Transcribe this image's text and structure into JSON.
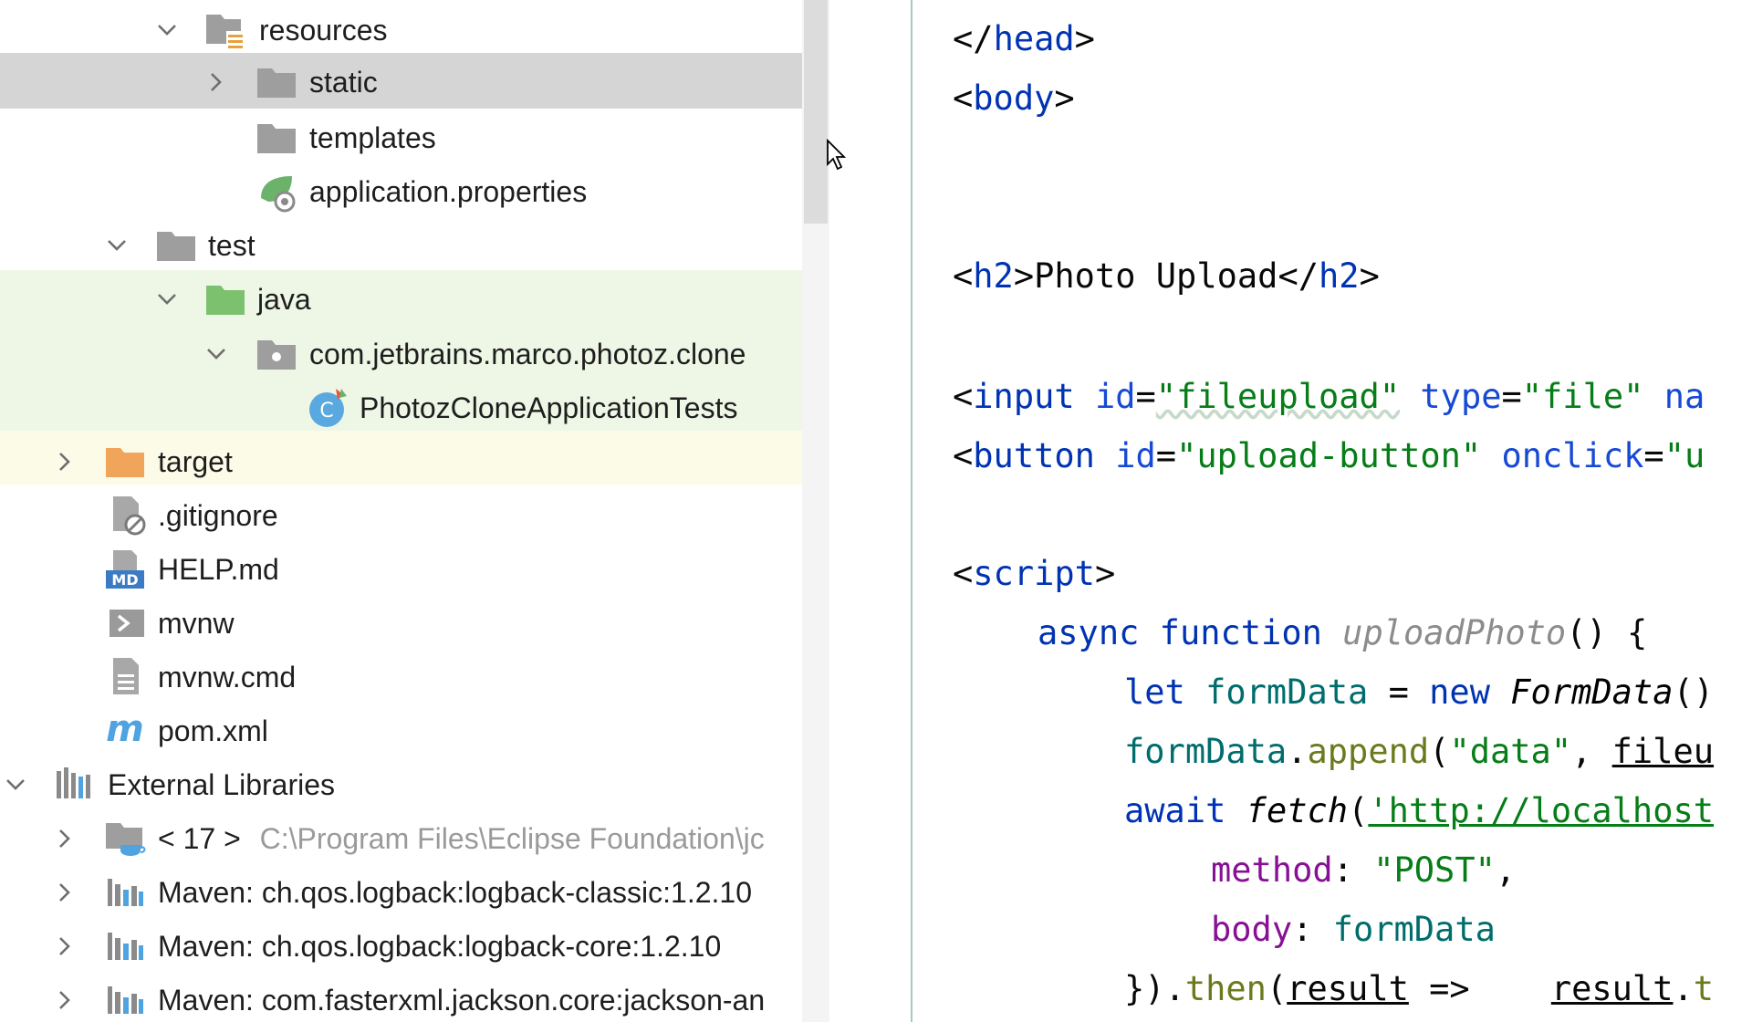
{
  "project_tree": {
    "rows": [
      {
        "label": "resources",
        "icon": "resources-folder-icon"
      },
      {
        "label": "static",
        "icon": "folder-icon"
      },
      {
        "label": "templates",
        "icon": "folder-icon"
      },
      {
        "label": "application.properties",
        "icon": "spring-properties-icon"
      },
      {
        "label": "test",
        "icon": "folder-icon"
      },
      {
        "label": "java",
        "icon": "test-source-folder-icon"
      },
      {
        "label": "com.jetbrains.marco.photoz.clone",
        "icon": "package-icon"
      },
      {
        "label": "PhotozCloneApplicationTests",
        "icon": "test-class-icon"
      },
      {
        "label": "target",
        "icon": "excluded-folder-icon"
      },
      {
        "label": ".gitignore",
        "icon": "ignored-file-icon"
      },
      {
        "label": "HELP.md",
        "icon": "markdown-file-icon"
      },
      {
        "label": "mvnw",
        "icon": "shell-script-icon"
      },
      {
        "label": "mvnw.cmd",
        "icon": "text-file-icon"
      },
      {
        "label": "pom.xml",
        "icon": "maven-icon"
      },
      {
        "label": "External Libraries",
        "icon": "libraries-icon"
      },
      {
        "label": "< 17 >",
        "sublabel": "C:\\Program Files\\Eclipse Foundation\\jc",
        "icon": "jdk-icon"
      },
      {
        "label": "Maven: ch.qos.logback:logback-classic:1.2.10",
        "icon": "library-icon"
      },
      {
        "label": "Maven: ch.qos.logback:logback-core:1.2.10",
        "icon": "library-icon"
      },
      {
        "label": "Maven: com.fasterxml.jackson.core:jackson-an",
        "icon": "library-icon"
      }
    ]
  },
  "editor": {
    "lines": {
      "l1_tag": "head",
      "l2_tag": "body",
      "l3_tag_open": "h2",
      "l3_text": "Photo Upload",
      "l3_tag_close": "h2",
      "l4_tag": "input",
      "l4_attr1": "id",
      "l4_val1": "\"fileupload\"",
      "l4_attr2": "type",
      "l4_val2": "\"file\"",
      "l4_attr3": "na",
      "l5_tag": "button",
      "l5_attr1": "id",
      "l5_val1": "\"upload-button\"",
      "l5_attr2": "onclick",
      "l5_val2": "\"u",
      "l6_tag": "script",
      "l7_kw1": "async",
      "l7_kw2": "function",
      "l7_fn": "uploadPhoto",
      "l7_rest": "() {",
      "l8_kw": "let",
      "l8_var": "formData",
      "l8_eq": " = ",
      "l8_new": "new",
      "l8_cls": "FormData",
      "l8_rest": "()",
      "l9_var": "formData",
      "l9_dot": ".",
      "l9_meth": "append",
      "l9_open": "(",
      "l9_str": "\"data\"",
      "l9_comma": ", ",
      "l9_arg": "fileu",
      "l10_kw": "await",
      "l10_fn": "fetch",
      "l10_open": "(",
      "l10_str": "'http://localhost",
      "l11_prop": "method",
      "l11_colon": ": ",
      "l11_str": "\"POST\"",
      "l11_comma": ",",
      "l12_prop": "body",
      "l12_colon": ": ",
      "l12_var": "formData",
      "l13_open": "}).",
      "l13_meth": "then",
      "l13_paren": "(",
      "l13_arg": "result",
      "l13_arrow": " =>    ",
      "l13_res": "result",
      "l13_dot": ".",
      "l13_t": "t"
    }
  },
  "colors": {
    "selected_row": "#d5d5d5",
    "test_highlight": "#eef6e6",
    "excluded_highlight": "#fbfbe8"
  }
}
